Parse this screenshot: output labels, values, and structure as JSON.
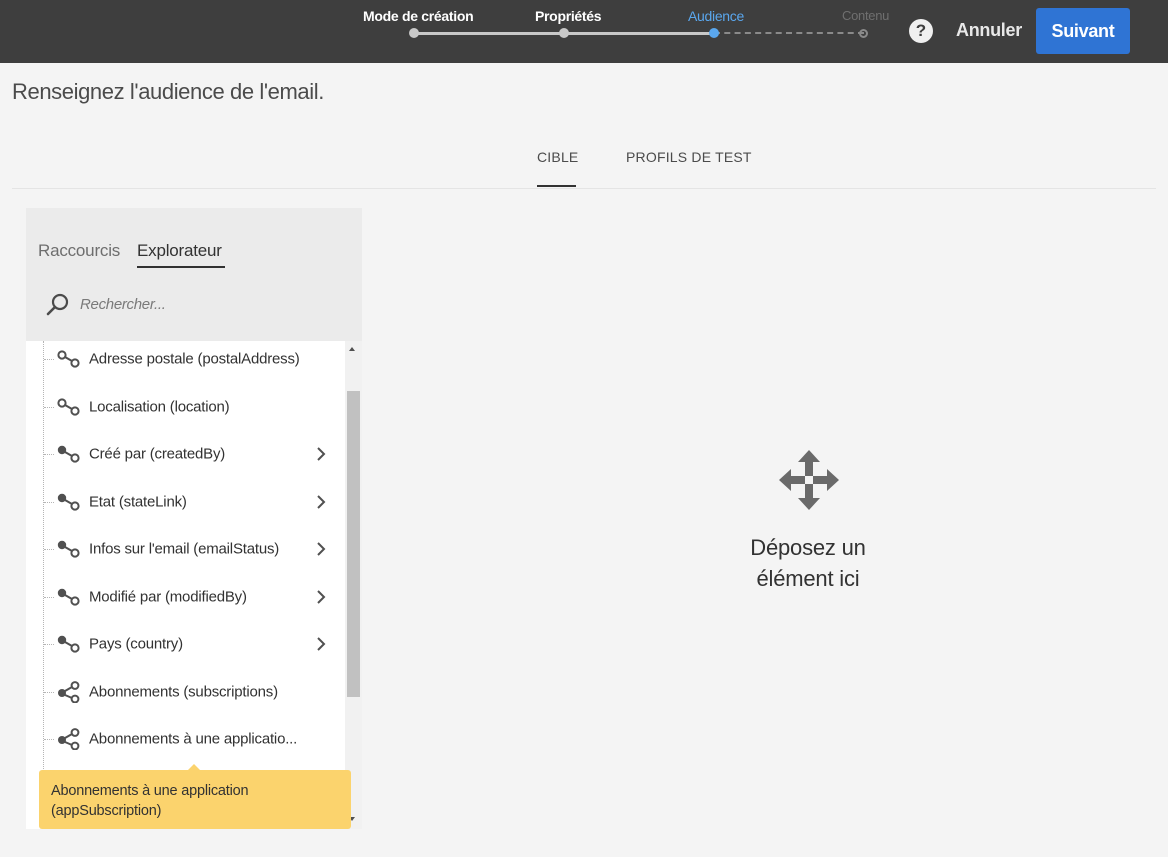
{
  "stepper": {
    "steps": [
      {
        "label": "Mode de création",
        "state": "done"
      },
      {
        "label": "Propriétés",
        "state": "done"
      },
      {
        "label": "Audience",
        "state": "active"
      },
      {
        "label": "Contenu",
        "state": "todo"
      }
    ]
  },
  "header": {
    "help_label": "?",
    "cancel_label": "Annuler",
    "next_label": "Suivant"
  },
  "page": {
    "title": "Renseignez l'audience de l'email."
  },
  "tabs": [
    {
      "label": "CIBLE",
      "active": true
    },
    {
      "label": "PROFILS DE TEST",
      "active": false
    }
  ],
  "panel": {
    "tabs": [
      {
        "label": "Raccourcis",
        "active": false
      },
      {
        "label": "Explorateur",
        "active": true
      }
    ],
    "search_placeholder": "Rechercher...",
    "items": [
      {
        "label": "Adresse postale (postalAddress)",
        "icon": "link-icon",
        "expandable": false
      },
      {
        "label": "Localisation (location)",
        "icon": "link-icon",
        "expandable": false
      },
      {
        "label": "Créé par (createdBy)",
        "icon": "link-filled-icon",
        "expandable": true
      },
      {
        "label": "Etat (stateLink)",
        "icon": "link-filled-icon",
        "expandable": true
      },
      {
        "label": "Infos sur l'email (emailStatus)",
        "icon": "link-filled-icon",
        "expandable": true
      },
      {
        "label": "Modifié par (modifiedBy)",
        "icon": "link-filled-icon",
        "expandable": true
      },
      {
        "label": "Pays (country)",
        "icon": "link-filled-icon",
        "expandable": true
      },
      {
        "label": "Abonnements (subscriptions)",
        "icon": "share-icon",
        "expandable": false
      },
      {
        "label": "Abonnements à une applicatio...",
        "icon": "share-icon",
        "expandable": false
      }
    ],
    "tooltip_line1": "Abonnements à une application",
    "tooltip_line2": "(appSubscription)"
  },
  "dropzone": {
    "line1": "Déposez un",
    "line2": "élément ici",
    "icon": "move-icon"
  },
  "colors": {
    "topbar": "#3e3e3e",
    "accent": "#2f74d4",
    "active_step": "#5aa7ee",
    "tooltip": "#fbd36d"
  }
}
